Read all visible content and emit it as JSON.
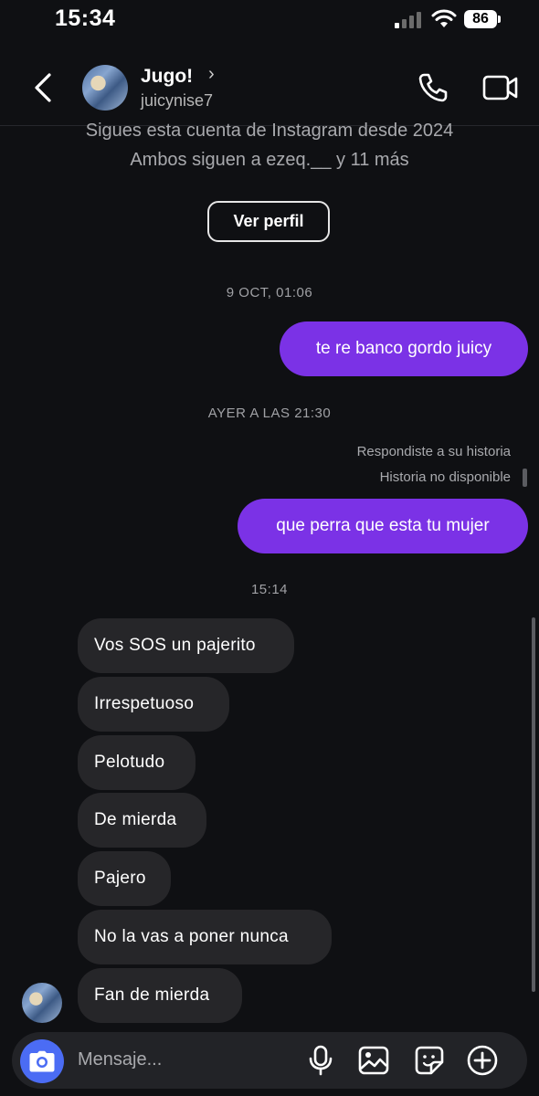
{
  "status_bar": {
    "time": "15:34",
    "battery": "86"
  },
  "header": {
    "name": "Jugo!",
    "chevron": "›",
    "username": "juicynise7"
  },
  "profile_info": {
    "line1": "Sigues esta cuenta de Instagram desde 2024",
    "line2": "Ambos siguen a ezeq.__ y 11 más",
    "view_profile_label": "Ver perfil"
  },
  "messages": {
    "stamp1": "9 OCT, 01:06",
    "out1": "te re banco gordo juicy",
    "stamp2": "AYER A LAS 21:30",
    "story_reply_note": "Respondiste a su historia",
    "story_unavailable": "Historia no disponible",
    "out2": "que perra que esta tu mujer",
    "stamp3": "15:14",
    "incoming": [
      "Vos SOS un pajerito",
      "Irrespetuoso",
      "Pelotudo",
      "De mierda",
      "Pajero",
      "No la vas a poner nunca",
      "Fan de mierda"
    ]
  },
  "composer": {
    "placeholder": "Mensaje..."
  },
  "colors": {
    "accent_purple": "#7b32e6",
    "camera_blue": "#4b6cf4",
    "incoming_bubble": "#262629",
    "background": "#0f1013"
  }
}
